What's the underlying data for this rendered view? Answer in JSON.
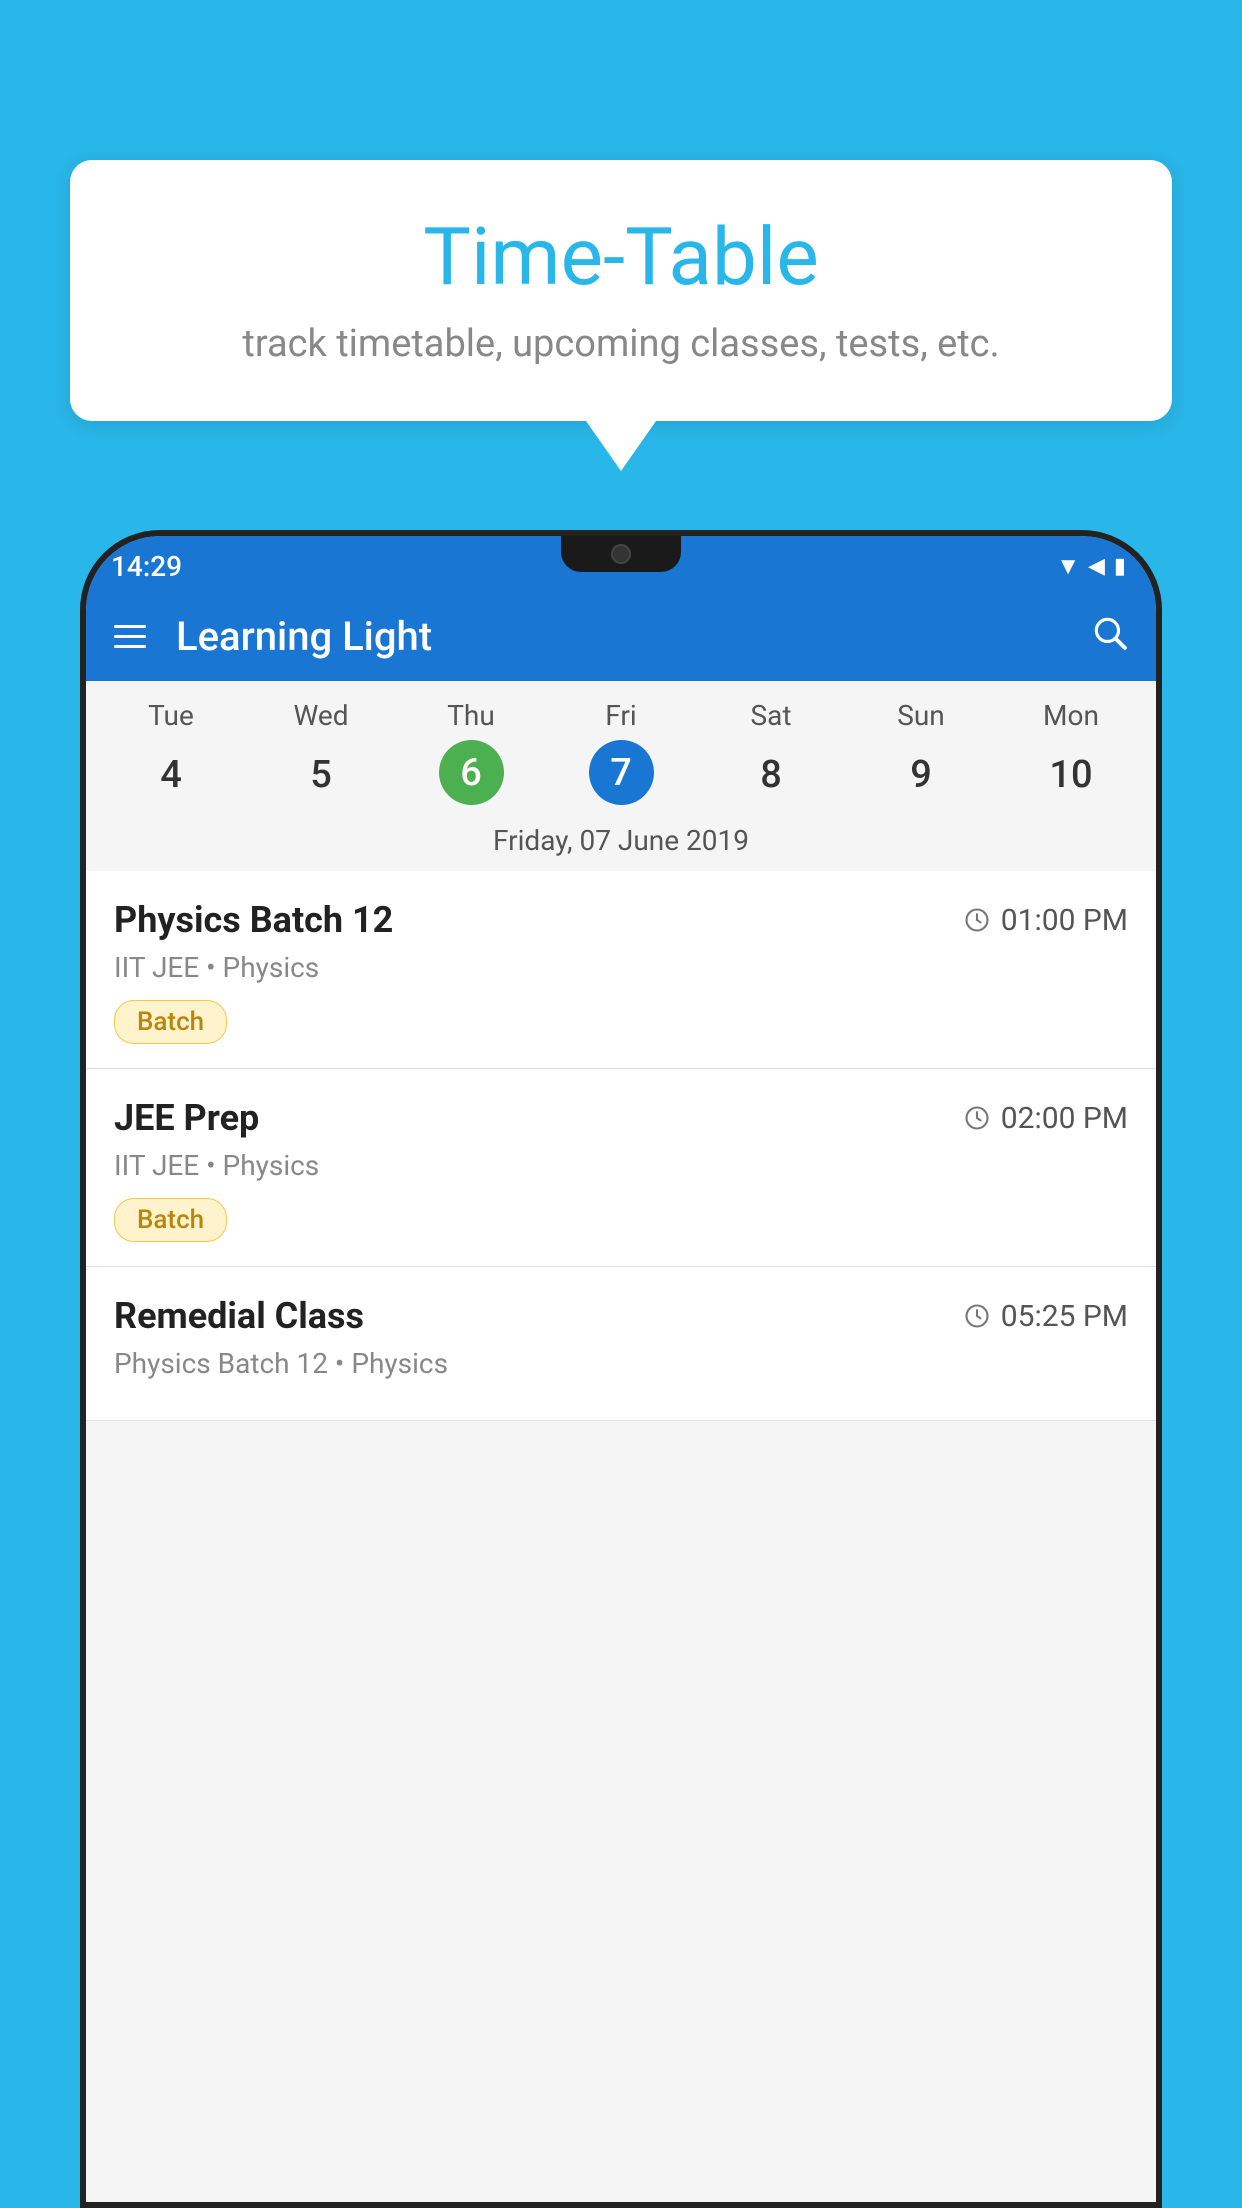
{
  "background_color": "#29b6e8",
  "speech_bubble": {
    "title": "Time-Table",
    "subtitle": "track timetable, upcoming classes, tests, etc."
  },
  "app": {
    "name": "Learning Light",
    "status_time": "14:29"
  },
  "calendar": {
    "days": [
      {
        "name": "Tue",
        "number": "4",
        "state": "normal"
      },
      {
        "name": "Wed",
        "number": "5",
        "state": "normal"
      },
      {
        "name": "Thu",
        "number": "6",
        "state": "today"
      },
      {
        "name": "Fri",
        "number": "7",
        "state": "selected"
      },
      {
        "name": "Sat",
        "number": "8",
        "state": "normal"
      },
      {
        "name": "Sun",
        "number": "9",
        "state": "normal"
      },
      {
        "name": "Mon",
        "number": "10",
        "state": "normal"
      }
    ],
    "selected_date_label": "Friday, 07 June 2019"
  },
  "schedule": [
    {
      "title": "Physics Batch 12",
      "time": "01:00 PM",
      "sub": "IIT JEE • Physics",
      "tag": "Batch"
    },
    {
      "title": "JEE Prep",
      "time": "02:00 PM",
      "sub": "IIT JEE • Physics",
      "tag": "Batch"
    },
    {
      "title": "Remedial Class",
      "time": "05:25 PM",
      "sub": "Physics Batch 12 • Physics",
      "tag": ""
    }
  ]
}
